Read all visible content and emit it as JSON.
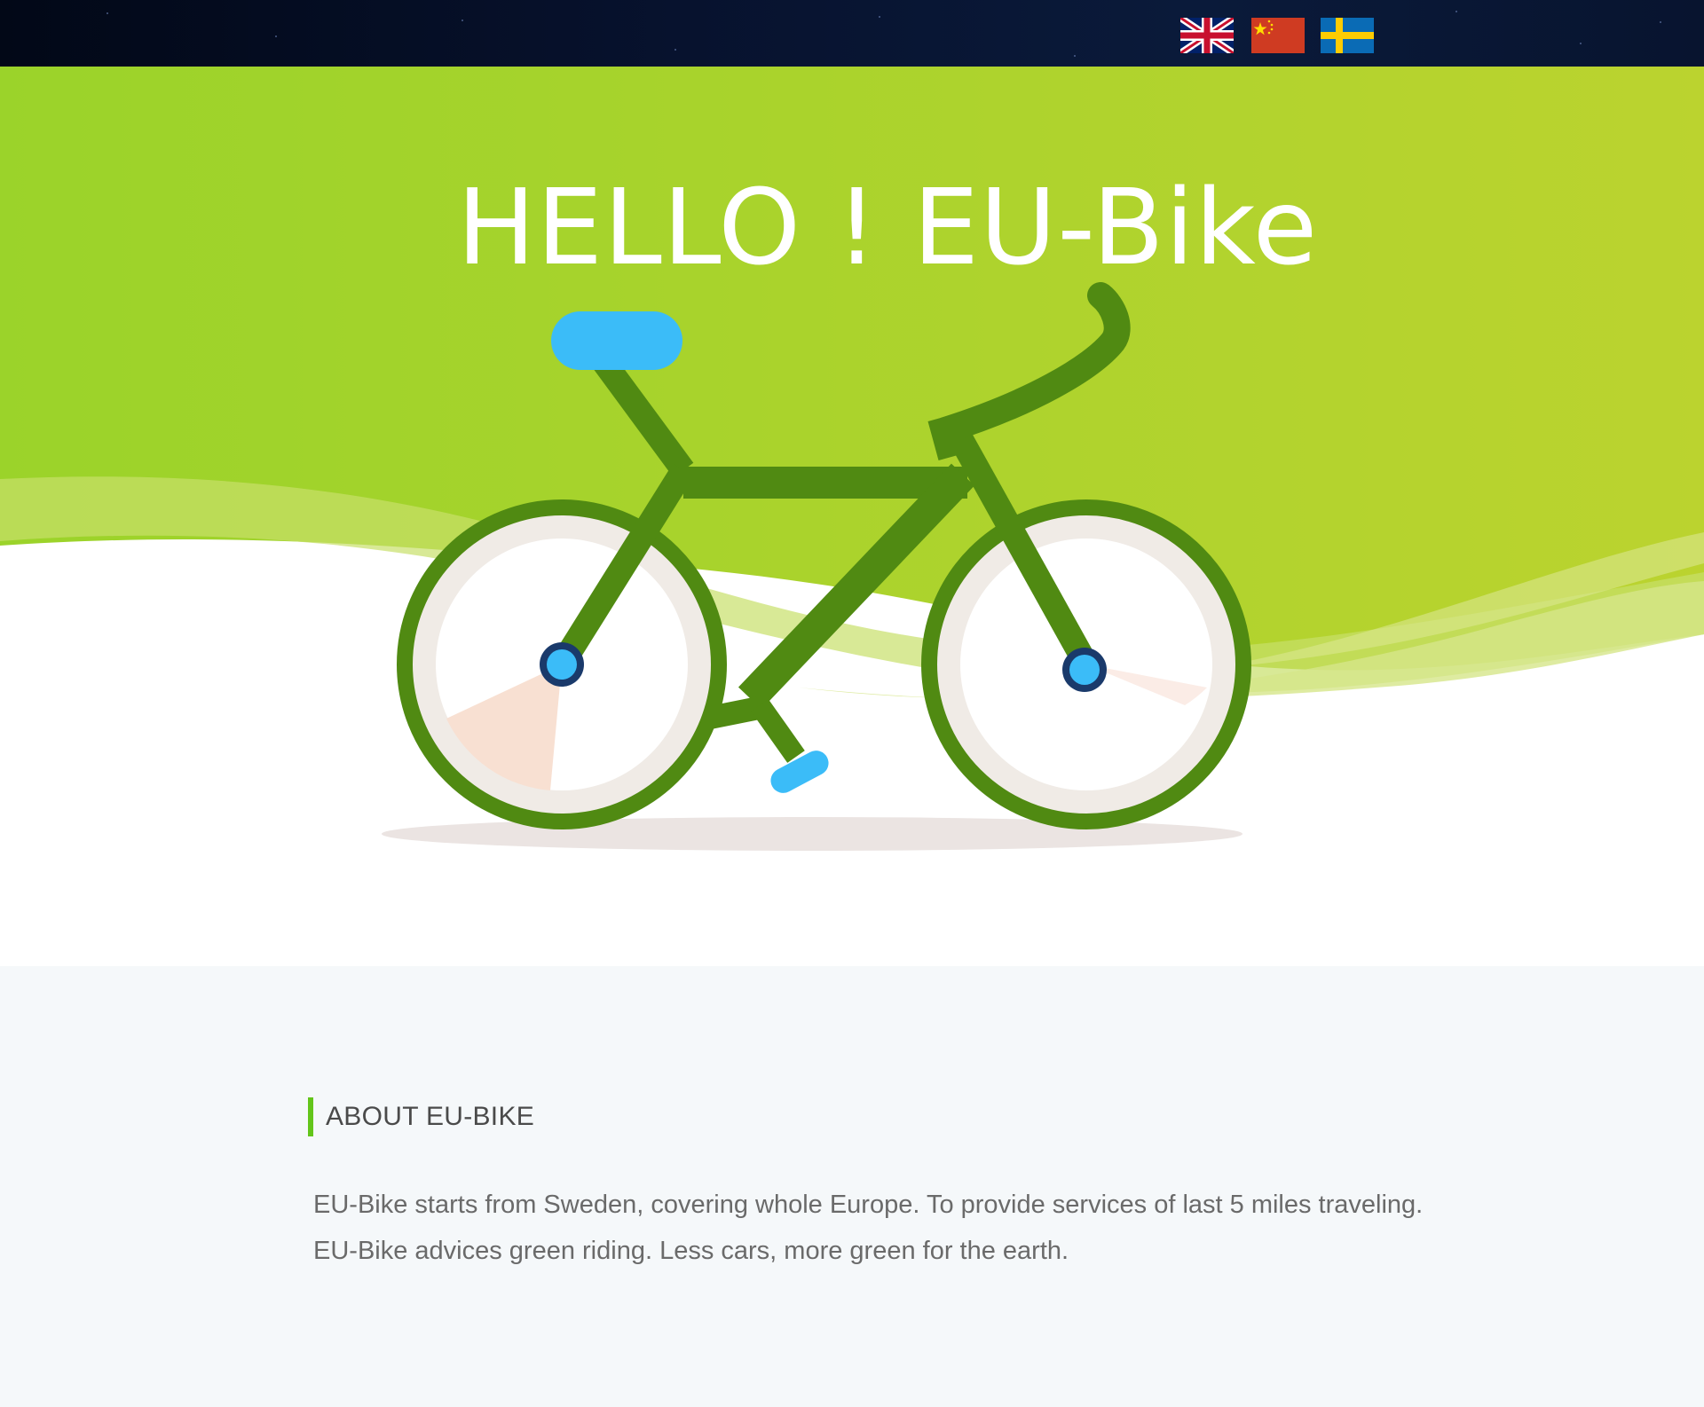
{
  "header": {
    "languages": [
      {
        "name": "English",
        "icon": "uk-flag-icon"
      },
      {
        "name": "Chinese",
        "icon": "china-flag-icon"
      },
      {
        "name": "Swedish",
        "icon": "sweden-flag-icon"
      }
    ]
  },
  "hero": {
    "title": "HELLO ! EU-Bike",
    "illustration": "bicycle-illustration"
  },
  "about": {
    "heading": "ABOUT EU-BIKE",
    "paragraph1": "EU-Bike starts from Sweden, covering whole Europe. To provide services of last 5 miles traveling.",
    "paragraph2": "EU-Bike advices green riding. Less cars, more green for the earth."
  },
  "colors": {
    "accent_green": "#63c51a",
    "hero_green": "#a6d62a",
    "bike_frame": "#508a12",
    "bike_blue": "#3bbcf8",
    "topbar": "#061028"
  }
}
